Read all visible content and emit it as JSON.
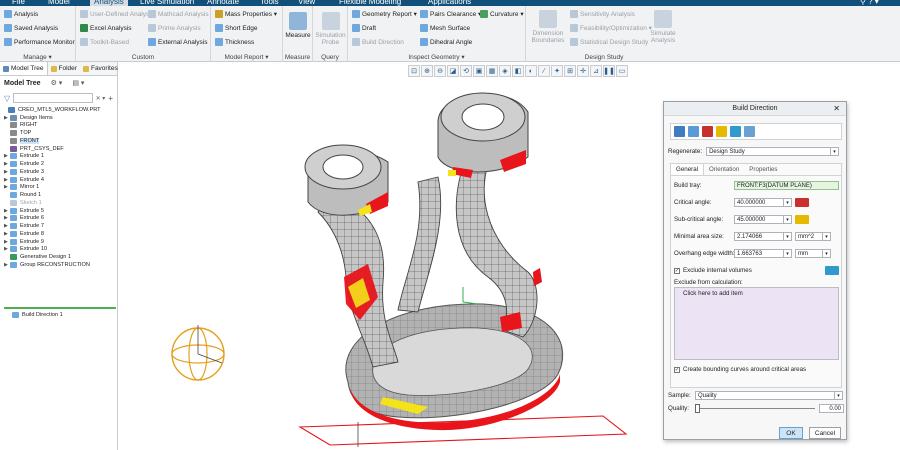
{
  "menu": {
    "items": [
      {
        "label": "File",
        "active": false
      },
      {
        "label": "Model",
        "active": false
      },
      {
        "label": "Analysis",
        "active": true
      },
      {
        "label": "Live Simulation",
        "active": false
      },
      {
        "label": "Annotate",
        "active": false
      },
      {
        "label": "Tools",
        "active": false
      },
      {
        "label": "View",
        "active": false
      },
      {
        "label": "Flexible Modeling",
        "active": false
      },
      {
        "label": "Applications",
        "active": false
      }
    ]
  },
  "ribbon": {
    "manage": {
      "label": "Manage ▾",
      "analysis": "Analysis",
      "saved_analysis": "Saved Analysis",
      "performance_monitor": "Performance Monitor"
    },
    "custom": {
      "label": "Custom",
      "user_defined": "User-Defined Analysis",
      "excel": "Excel Analysis",
      "toolkit": "Toolkit-Based",
      "mathcad": "Mathcad Analysis",
      "prime": "Prime Analysis",
      "external": "External Analysis"
    },
    "model_report": {
      "label": "Model Report ▾",
      "mass_properties": "Mass Properties ▾",
      "short_edge": "Short Edge",
      "thickness": "Thickness"
    },
    "measure": {
      "label": "Measure",
      "button": "Measure"
    },
    "query": {
      "label": "Query",
      "button": "Simulation Probe"
    },
    "inspect": {
      "label": "Inspect Geometry ▾",
      "geometry_report": "Geometry Report ▾",
      "draft": "Draft",
      "build_direction": "Build Direction",
      "pairs_clearance": "Pairs Clearance ▾",
      "mesh_surface": "Mesh Surface",
      "dihedral_angle": "Dihedral Angle",
      "curvature": "Curvature ▾"
    },
    "design_study": {
      "label": "Design Study",
      "dimension_boundaries": "Dimension Boundaries",
      "sensitivity": "Sensitivity Analysis",
      "feasibility": "Feasibility/Optimization ▾",
      "statistical": "Statistical Design Study",
      "simulate": "Simulate Analysis"
    }
  },
  "left_panel": {
    "tabs": [
      "Model Tree",
      "Folder",
      "Favorites"
    ],
    "header": "Model Tree",
    "tree": [
      {
        "label": "CREO_MTL5_WORKFLOW.PRT",
        "icon": "part-icon",
        "twisty": "",
        "state": "normal",
        "color": "#4a7fb5"
      },
      {
        "label": "Design Items",
        "icon": "design-items-icon",
        "twisty": "▶",
        "state": "normal",
        "color": "#6b8fb5"
      },
      {
        "label": "RIGHT",
        "icon": "datum-plane-icon",
        "twisty": "",
        "state": "normal",
        "color": "#8a8a8a"
      },
      {
        "label": "TOP",
        "icon": "datum-plane-icon",
        "twisty": "",
        "state": "normal",
        "color": "#8a8a8a"
      },
      {
        "label": "FRONT",
        "icon": "datum-plane-icon",
        "twisty": "",
        "state": "selected",
        "color": "#8a8a8a"
      },
      {
        "label": "PRT_CSYS_DEF",
        "icon": "csys-icon",
        "twisty": "",
        "state": "normal",
        "color": "#7a5a9a"
      },
      {
        "label": "Extrude 1",
        "icon": "extrude-icon",
        "twisty": "▶",
        "state": "normal",
        "color": "#6fa8dc"
      },
      {
        "label": "Extrude 2",
        "icon": "extrude-icon",
        "twisty": "▶",
        "state": "normal",
        "color": "#6fa8dc"
      },
      {
        "label": "Extrude 3",
        "icon": "extrude-icon",
        "twisty": "▶",
        "state": "normal",
        "color": "#6fa8dc"
      },
      {
        "label": "Extrude 4",
        "icon": "extrude-icon",
        "twisty": "▶",
        "state": "normal",
        "color": "#6fa8dc"
      },
      {
        "label": "Mirror 1",
        "icon": "mirror-icon",
        "twisty": "▶",
        "state": "normal",
        "color": "#6fa8dc"
      },
      {
        "label": "Round 1",
        "icon": "round-icon",
        "twisty": "",
        "state": "normal",
        "color": "#6fa8dc"
      },
      {
        "label": "Sketch 1",
        "icon": "sketch-icon",
        "twisty": "",
        "state": "dim",
        "color": "#b5c8dc"
      },
      {
        "label": "Extrude 5",
        "icon": "extrude-icon",
        "twisty": "▶",
        "state": "normal",
        "color": "#6fa8dc"
      },
      {
        "label": "Extrude 6",
        "icon": "extrude-icon",
        "twisty": "▶",
        "state": "normal",
        "color": "#6fa8dc"
      },
      {
        "label": "Extrude 7",
        "icon": "extrude-icon",
        "twisty": "▶",
        "state": "normal",
        "color": "#6fa8dc"
      },
      {
        "label": "Extrude 8",
        "icon": "extrude-icon",
        "twisty": "▶",
        "state": "normal",
        "color": "#6fa8dc"
      },
      {
        "label": "Extrude 9",
        "icon": "extrude-icon",
        "twisty": "▶",
        "state": "normal",
        "color": "#6fa8dc"
      },
      {
        "label": "Extrude 10",
        "icon": "extrude-icon",
        "twisty": "▶",
        "state": "normal",
        "color": "#6fa8dc"
      },
      {
        "label": "Generative Design 1",
        "icon": "generative-icon",
        "twisty": "",
        "state": "normal",
        "color": "#3a9a5a"
      },
      {
        "label": "Group RECONSTRUCTION",
        "icon": "group-icon",
        "twisty": "▶",
        "state": "normal",
        "color": "#6fa8dc"
      }
    ],
    "footer_item": "Build Direction 1"
  },
  "dialog": {
    "title": "Build Direction",
    "regenerate_label": "Regenerate:",
    "regenerate_value": "Design Study",
    "tabs": [
      "General",
      "Orientation",
      "Properties"
    ],
    "build_tray_label": "Build tray:",
    "build_tray_value": "FRONT:F3(DATUM PLANE)",
    "critical_angle_label": "Critical angle:",
    "critical_angle_value": "40.000000",
    "subcritical_angle_label": "Sub-critical angle:",
    "subcritical_angle_value": "45.000000",
    "min_area_label": "Minimal area size:",
    "min_area_value": "2.174066",
    "min_area_unit": "mm^2",
    "overhang_label": "Overhang edge width:",
    "overhang_value": "1.663763",
    "overhang_unit": "mm",
    "exclude_internal_label": "Exclude internal volumes",
    "exclude_from_calc_label": "Exclude from calculation:",
    "exclude_placeholder": "Click here to add item",
    "bounding_curves_label": "Create bounding curves around critical areas",
    "sample_label": "Sample:",
    "sample_value": "Quality",
    "quality_label": "Quality:",
    "quality_value": "0.00",
    "ok_label": "OK",
    "cancel_label": "Cancel"
  },
  "colors": {
    "menubar": "#10507a",
    "critical": "#e8151b",
    "subcritical": "#f4e21a",
    "part": "#aeaeae",
    "tray": "#e8151b"
  }
}
